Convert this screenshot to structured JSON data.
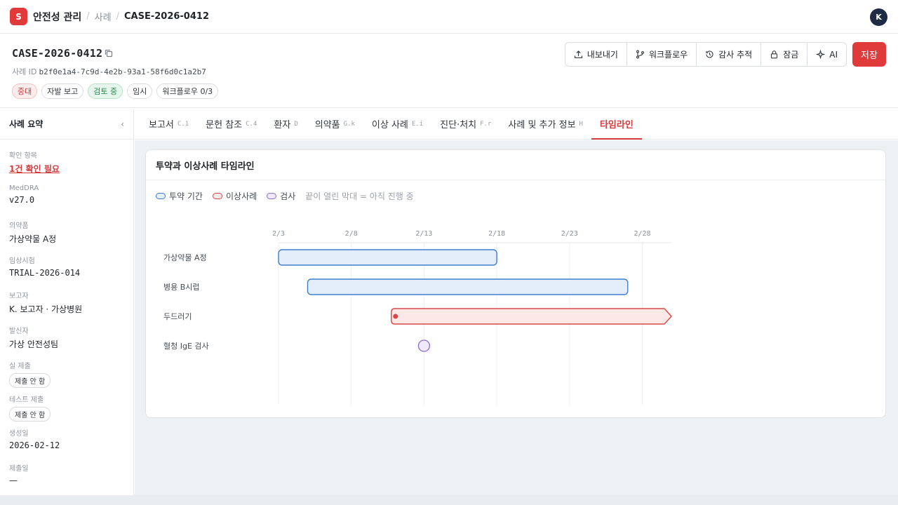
{
  "topbar": {
    "logo_letter": "S",
    "app_title": "안전성 관리",
    "breadcrumb_parent": "사례",
    "breadcrumb_current": "CASE-2026-0412",
    "avatar_initial": "K"
  },
  "header": {
    "case_title": "CASE-2026-0412",
    "case_id_label": "사례 ID",
    "case_id_value": "b2f0e1a4-7c9d-4e2b-93a1-58f6d0c1a2b7",
    "badges": [
      "중대",
      "자발 보고",
      "검토 중",
      "임시",
      "워크플로우 0/3"
    ],
    "actions": {
      "export": "내보내기",
      "workflow": "워크플로우",
      "audit": "감사 추적",
      "lock": "잠금",
      "ai": "AI"
    },
    "save_label": "저장"
  },
  "sidebar": {
    "title": "사례 요약",
    "collapse_glyph": "‹",
    "items": [
      {
        "label": "확인 항목",
        "value": "1건 확인 필요"
      },
      {
        "label": "MedDRA",
        "value": "v27.0"
      },
      {
        "label": "의약품",
        "value": "가상약물 A정"
      },
      {
        "label": "임상시험",
        "value": "TRIAL-2026-014"
      },
      {
        "label": "보고자",
        "value": "K. 보고자 · 가상병원"
      },
      {
        "label": "발신자",
        "value": "가상 안전성팀"
      },
      {
        "label": "실 제출",
        "value": "제출 안 함"
      },
      {
        "label": "테스트 제출",
        "value": "제출 안 함"
      },
      {
        "label": "생성일",
        "value": "2026-02-12"
      },
      {
        "label": "제출일",
        "value": "—"
      }
    ]
  },
  "tabs": [
    {
      "label": "보고서",
      "code": "C.1"
    },
    {
      "label": "문헌 참조",
      "code": "C.4"
    },
    {
      "label": "환자",
      "code": "D"
    },
    {
      "label": "의약품",
      "code": "G.k"
    },
    {
      "label": "이상 사례",
      "code": "E.i"
    },
    {
      "label": "진단·처치",
      "code": "F.r"
    },
    {
      "label": "사례 및 추가 정보",
      "code": "H"
    },
    {
      "label": "타임라인",
      "code": ""
    }
  ],
  "timeline": {
    "card_title": "투약과 이상사례 타임라인",
    "legend": {
      "drug": "투약 기간",
      "event": "이상사례",
      "test": "검사",
      "note": "끝이 열린 막대 = 아직 진행 중"
    },
    "colors": {
      "drug_fill": "#e4eefa",
      "drug_stroke": "#3d7fcc",
      "event_fill": "#fde8e8",
      "event_stroke": "#d94848",
      "test_fill": "#efe9fb",
      "test_stroke": "#8a6dcc"
    }
  },
  "chart_data": {
    "type": "gantt",
    "x_ticks": [
      "2/3",
      "2/8",
      "2/13",
      "2/18",
      "2/23",
      "2/28"
    ],
    "x_range_days": [
      3,
      30
    ],
    "rows": [
      {
        "label": "가상약물 A정",
        "kind": "drug",
        "start": 3,
        "end": 18,
        "ongoing": false
      },
      {
        "label": "병용 B시럽",
        "kind": "drug",
        "start": 5,
        "end": 27,
        "ongoing": false
      },
      {
        "label": "두드러기",
        "kind": "event",
        "start": 10.75,
        "end": 30,
        "ongoing": true
      },
      {
        "label": "혈청 IgE 검사",
        "kind": "test",
        "start": 13,
        "end": 13,
        "ongoing": false
      }
    ]
  }
}
